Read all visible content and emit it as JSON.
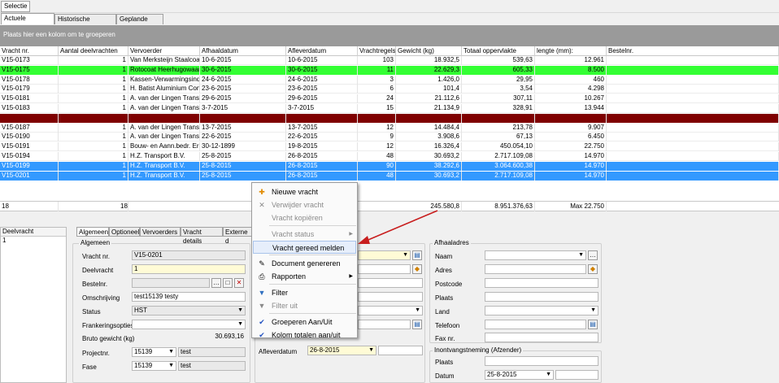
{
  "toolbar": {
    "selectie": "Selectie"
  },
  "tabs": [
    "Actuele vrachten",
    "Historische vrachten",
    "Geplande ritten"
  ],
  "group_prompt": "Plaats hier een kolom om te groeperen",
  "columns": [
    "Vracht nr.",
    "Aantal deelvrachten",
    "Vervoerder",
    "Afhaaldatum",
    "Afleverdatum",
    "Vrachtregels",
    "Gewicht (kg)",
    "Totaal oppervlakte",
    "lengte (mm):",
    "Bestelnr."
  ],
  "rows": [
    {
      "nr": "V15-0173",
      "aantal": "1",
      "vervoerder": "Van Merksteijn Staalcoatin",
      "afhaal": "10-6-2015",
      "aflever": "10-6-2015",
      "regels": "103",
      "gewicht": "18.932,5",
      "opp": "539,63",
      "lengte": "12.961",
      "bestel": "",
      "style": "normal"
    },
    {
      "nr": "V15-0175",
      "aantal": "1",
      "vervoerder": "Rotocoat Heerhugowaard",
      "afhaal": "30-6-2015",
      "aflever": "30-6-2015",
      "regels": "11",
      "gewicht": "22.629,3",
      "opp": "605,33",
      "lengte": "8.500",
      "bestel": "",
      "style": "green"
    },
    {
      "nr": "V15-0178",
      "aantal": "1",
      "vervoerder": "Kassen-Verwarmingsindus",
      "afhaal": "24-6-2015",
      "aflever": "24-6-2015",
      "regels": "3",
      "gewicht": "1.426,0",
      "opp": "29,95",
      "lengte": "460",
      "bestel": "",
      "style": "normal"
    },
    {
      "nr": "V15-0179",
      "aantal": "1",
      "vervoerder": "H. Batist Aluminium Const",
      "afhaal": "23-6-2015",
      "aflever": "23-6-2015",
      "regels": "6",
      "gewicht": "101,4",
      "opp": "3,54",
      "lengte": "4.298",
      "bestel": "",
      "style": "normal"
    },
    {
      "nr": "V15-0181",
      "aantal": "1",
      "vervoerder": "A. van der Lingen Transp",
      "afhaal": "29-6-2015",
      "aflever": "29-6-2015",
      "regels": "24",
      "gewicht": "21.112,6",
      "opp": "307,11",
      "lengte": "10.267",
      "bestel": "",
      "style": "normal"
    },
    {
      "nr": "V15-0183",
      "aantal": "1",
      "vervoerder": "A. van der Lingen Transp",
      "afhaal": "3-7-2015",
      "aflever": "3-7-2015",
      "regels": "15",
      "gewicht": "21.134,9",
      "opp": "328,91",
      "lengte": "13.944",
      "bestel": "",
      "style": "normal"
    },
    {
      "nr": "",
      "aantal": "",
      "vervoerder": "",
      "afhaal": "",
      "aflever": "",
      "regels": "",
      "gewicht": "",
      "opp": "",
      "lengte": "",
      "bestel": "",
      "style": "red"
    },
    {
      "nr": "V15-0187",
      "aantal": "1",
      "vervoerder": "A. van der Lingen Transp",
      "afhaal": "13-7-2015",
      "aflever": "13-7-2015",
      "regels": "12",
      "gewicht": "14.484,4",
      "opp": "213,78",
      "lengte": "9.907",
      "bestel": "",
      "style": "normal"
    },
    {
      "nr": "V15-0190",
      "aantal": "1",
      "vervoerder": "A. van der Lingen Transp",
      "afhaal": "22-6-2015",
      "aflever": "22-6-2015",
      "regels": "9",
      "gewicht": "3.908,6",
      "opp": "67,13",
      "lengte": "6.450",
      "bestel": "",
      "style": "normal"
    },
    {
      "nr": "V15-0191",
      "aantal": "1",
      "vervoerder": "Bouw- en Aann.bedr. Ern",
      "afhaal": "30-12-1899",
      "aflever": "19-8-2015",
      "regels": "12",
      "gewicht": "16.326,4",
      "opp": "450.054,10",
      "lengte": "22.750",
      "bestel": "",
      "style": "normal"
    },
    {
      "nr": "V15-0194",
      "aantal": "1",
      "vervoerder": "H.Z. Transport B.V.",
      "afhaal": "25-8-2015",
      "aflever": "26-8-2015",
      "regels": "48",
      "gewicht": "30.693,2",
      "opp": "2.717.109,08",
      "lengte": "14.970",
      "bestel": "",
      "style": "normal"
    },
    {
      "nr": "V15-0199",
      "aantal": "1",
      "vervoerder": "H.Z. Transport B.V.",
      "afhaal": "25-8-2015",
      "aflever": "26-8-2015",
      "regels": "90",
      "gewicht": "38.292,6",
      "opp": "3.064.600,38",
      "lengte": "14.970",
      "bestel": "",
      "style": "blue"
    },
    {
      "nr": "V15-0201",
      "aantal": "1",
      "vervoerder": "H.Z. Transport B.V.",
      "afhaal": "25-8-2015",
      "aflever": "26-8-2015",
      "regels": "48",
      "gewicht": "30.693,2",
      "opp": "2.717.109,08",
      "lengte": "14.970",
      "bestel": "",
      "style": "blue"
    }
  ],
  "totals": {
    "count": "18",
    "aantal": "18",
    "gewicht": "245.580,8",
    "opp": "8.951.376,63",
    "lengte": "Max 22.750"
  },
  "deelvracht": {
    "header": "Deelvracht",
    "value": "1"
  },
  "subtabs": [
    "Algemeen",
    "Optioneel",
    "Vervoerders",
    "Vracht details",
    "Externe d"
  ],
  "algemeen": {
    "title": "Algemeen",
    "vracht_nr_label": "Vracht nr.",
    "vracht_nr": "V15-0201",
    "deelvracht_label": "Deelvracht",
    "deelvracht": "1",
    "bestelnr_label": "Bestelnr.",
    "bestelnr": "",
    "omschrijving_label": "Omschrijving",
    "omschrijving": "test15139 testy",
    "status_label": "Status",
    "status": "HST",
    "franker_label": "Frankeringsopties",
    "franker": "",
    "bruto_label": "Bruto gewicht (kg)",
    "bruto": "30.693,16",
    "project_label": "Projectnr.",
    "project": "15139",
    "project_desc": "test",
    "fase_label": "Fase",
    "fase": "15139",
    "fase_desc": "test"
  },
  "middle": {
    "aflever_label": "Afleverdatum",
    "aflever": "26-8-2015"
  },
  "afhaal": {
    "title": "Afhaaladres",
    "naam_label": "Naam",
    "adres_label": "Adres",
    "postcode_label": "Postcode",
    "plaats_label": "Plaats",
    "land_label": "Land",
    "telefoon_label": "Telefoon",
    "fax_label": "Fax nr."
  },
  "inontvangst": {
    "title": "Inontvangstneming (Afzender)",
    "plaats_label": "Plaats",
    "datum_label": "Datum",
    "datum": "25-8-2015"
  },
  "menu": {
    "items": [
      {
        "label": "Nieuwe vracht",
        "icon": "new-icon",
        "glyph": "✚",
        "dis": false,
        "arrow": false
      },
      {
        "label": "Verwijder vracht",
        "icon": "delete-icon",
        "glyph": "✕",
        "dis": true,
        "arrow": false
      },
      {
        "label": "Vracht kopiëren",
        "icon": "copy-icon",
        "glyph": "",
        "dis": true,
        "arrow": false
      },
      {
        "label": "Vracht status",
        "icon": "",
        "glyph": "",
        "dis": true,
        "arrow": true
      },
      {
        "label": "Vracht gereed melden",
        "icon": "",
        "glyph": "",
        "dis": false,
        "arrow": false,
        "hl": true
      },
      {
        "label": "Document genereren",
        "icon": "document-icon",
        "glyph": "✎",
        "dis": false,
        "arrow": false
      },
      {
        "label": "Rapporten",
        "icon": "printer-icon",
        "glyph": "⎙",
        "dis": false,
        "arrow": true
      },
      {
        "label": "Filter",
        "icon": "filter-icon",
        "glyph": "▼",
        "dis": false,
        "arrow": false
      },
      {
        "label": "Filter uit",
        "icon": "filter-off-icon",
        "glyph": "▼",
        "dis": true,
        "arrow": false
      },
      {
        "label": "Groeperen Aan/Uit",
        "icon": "check-icon",
        "glyph": "✔",
        "dis": false,
        "arrow": false
      },
      {
        "label": "Kolom totalen aan/uit",
        "icon": "check-icon",
        "glyph": "✔",
        "dis": false,
        "arrow": false
      }
    ]
  },
  "colors": {
    "green": "#33ff33",
    "red": "#7f0000",
    "blue": "#3399ff",
    "group": "#9a9a9a"
  }
}
